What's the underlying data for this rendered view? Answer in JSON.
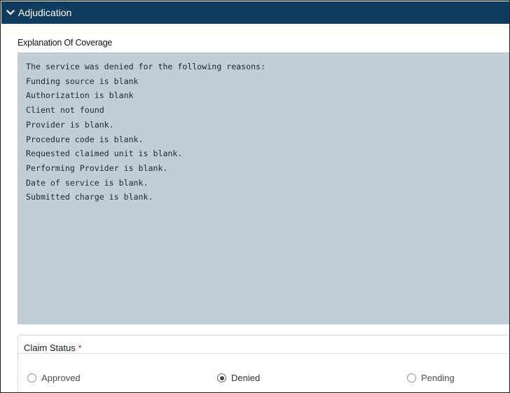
{
  "panel": {
    "title": "Adjudication"
  },
  "explanation_of_coverage": {
    "label": "Explanation Of Coverage",
    "lines": [
      "The service was denied for the following reasons:",
      "Funding source is blank",
      "Authorization is blank",
      "Client not found",
      "Provider is blank.",
      "Procedure code is blank.",
      "Requested claimed unit is blank.",
      "Performing Provider is blank.",
      "Date of service is blank.",
      "Submitted charge is blank."
    ]
  },
  "claim_status": {
    "label": "Claim Status",
    "required_marker": "*",
    "options": [
      {
        "label": "Approved",
        "checked": false
      },
      {
        "label": "Denied",
        "checked": true
      },
      {
        "label": "Pending",
        "checked": false
      }
    ]
  },
  "colors": {
    "header_bg": "#0f3c5e",
    "textarea_bg": "#c2cdd5",
    "required": "#d0021b"
  },
  "icons": {
    "header_toggle": "chevron-down-icon"
  }
}
